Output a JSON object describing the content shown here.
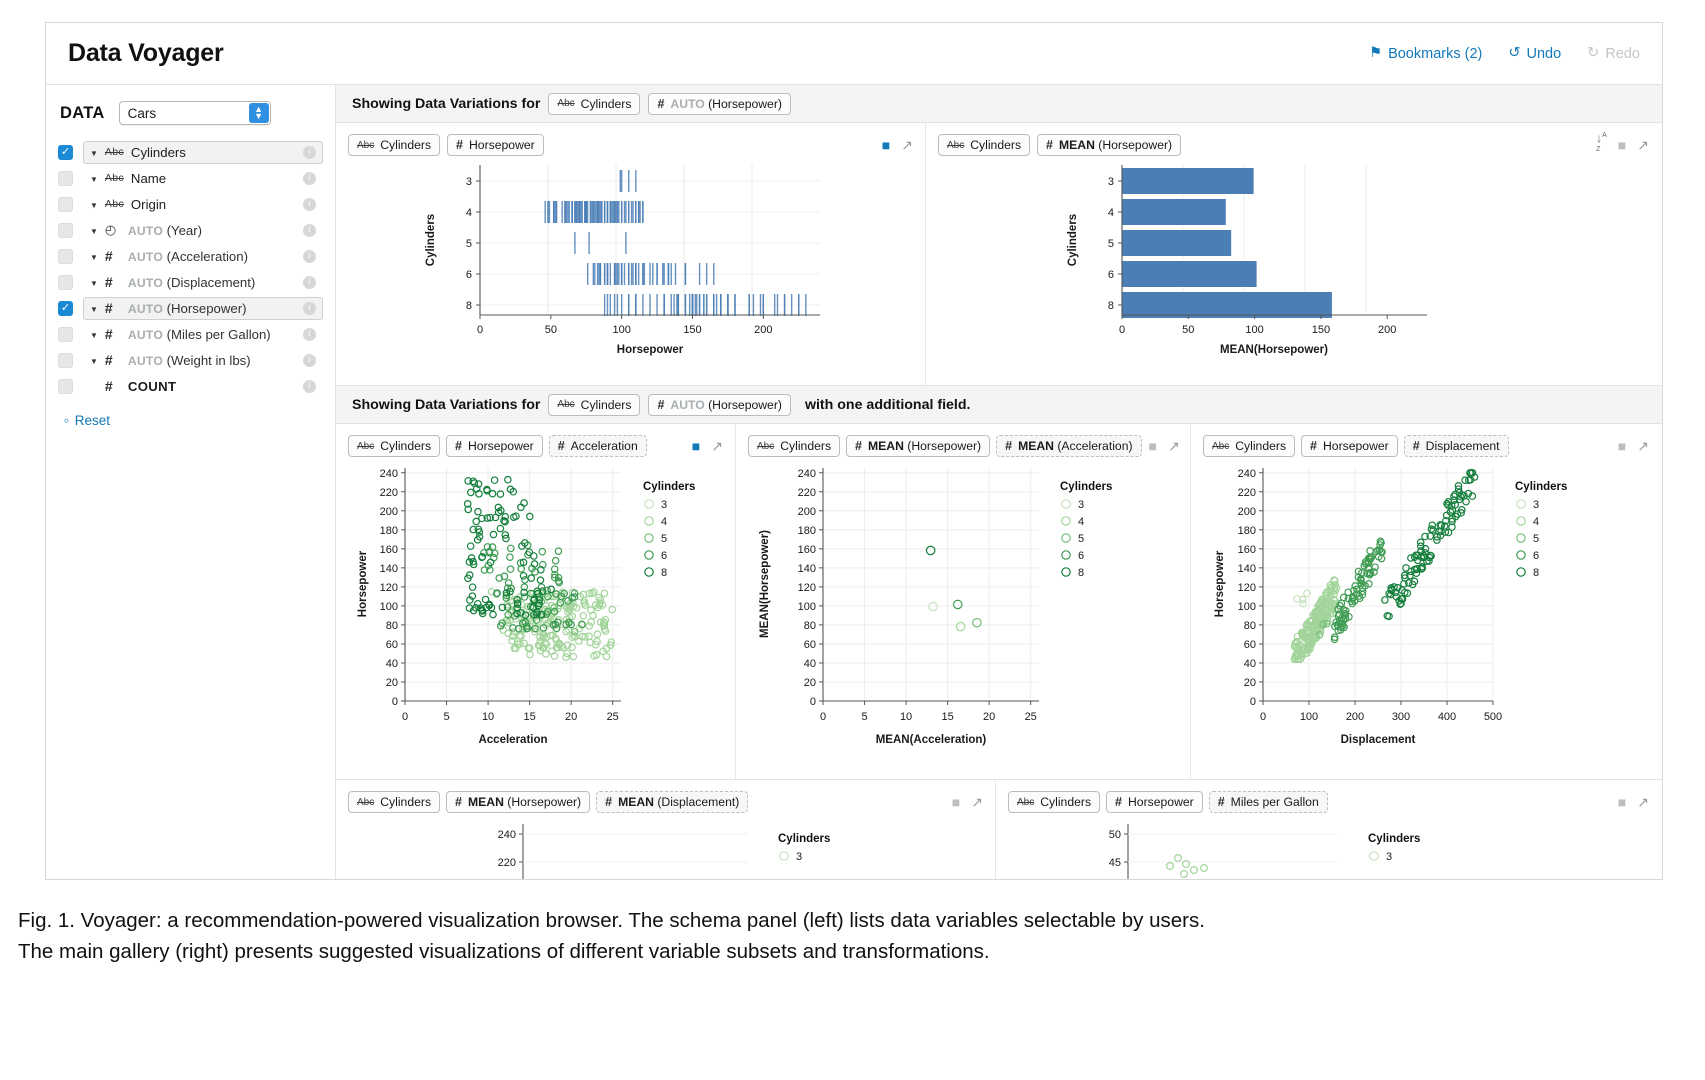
{
  "app": {
    "title": "Data Voyager",
    "toolbar": [
      {
        "name": "bookmarks",
        "label": "Bookmarks (2)",
        "icon": "bookmark-icon",
        "glyph": "⚑",
        "disabled": false
      },
      {
        "name": "undo",
        "label": "Undo",
        "icon": "undo-icon",
        "glyph": "↺",
        "disabled": false
      },
      {
        "name": "redo",
        "label": "Redo",
        "icon": "redo-icon",
        "glyph": "↻",
        "disabled": true
      }
    ]
  },
  "sidebar": {
    "heading": "DATA",
    "dataset": {
      "value": "Cars",
      "options": [
        "Cars"
      ]
    },
    "reset_label": "Reset",
    "reset_icon": "eraser-icon",
    "fields": [
      {
        "label": "Cylinders",
        "type": "abc",
        "type_glyph": "Abc",
        "checked": true,
        "selected": true,
        "auto": false,
        "caret": true,
        "bold": false
      },
      {
        "label": "Name",
        "type": "abc",
        "type_glyph": "Abc",
        "checked": false,
        "selected": false,
        "auto": false,
        "caret": true,
        "bold": false
      },
      {
        "label": "Origin",
        "type": "abc",
        "type_glyph": "Abc",
        "checked": false,
        "selected": false,
        "auto": false,
        "caret": true,
        "bold": false
      },
      {
        "label": "(Year)",
        "type": "clock",
        "type_glyph": "◴",
        "checked": false,
        "selected": false,
        "auto": true,
        "caret": true,
        "bold": false
      },
      {
        "label": "(Acceleration)",
        "type": "hash",
        "type_glyph": "#",
        "checked": false,
        "selected": false,
        "auto": true,
        "caret": true,
        "bold": false
      },
      {
        "label": "(Displacement)",
        "type": "hash",
        "type_glyph": "#",
        "checked": false,
        "selected": false,
        "auto": true,
        "caret": true,
        "bold": false
      },
      {
        "label": "(Horsepower)",
        "type": "hash",
        "type_glyph": "#",
        "checked": true,
        "selected": true,
        "auto": true,
        "caret": true,
        "bold": false
      },
      {
        "label": "(Miles per Gallon)",
        "type": "hash",
        "type_glyph": "#",
        "checked": false,
        "selected": false,
        "auto": true,
        "caret": true,
        "bold": false
      },
      {
        "label": "(Weight in lbs)",
        "type": "hash",
        "type_glyph": "#",
        "checked": false,
        "selected": false,
        "auto": true,
        "caret": true,
        "bold": false
      },
      {
        "label": "COUNT",
        "type": "hash",
        "type_glyph": "#",
        "checked": false,
        "selected": false,
        "auto": false,
        "caret": false,
        "bold": true
      }
    ],
    "auto_text": "AUTO",
    "info_glyph": "i"
  },
  "gallery": {
    "section1": {
      "prefix": "Showing Data Variations for",
      "suffix": "",
      "pills": [
        {
          "type": "abc",
          "glyph": "Abc",
          "label": "Cylinders",
          "auto": false,
          "dashed": false
        },
        {
          "type": "hash",
          "glyph": "#",
          "label": "(Horsepower)",
          "auto": true,
          "dashed": false
        }
      ]
    },
    "section2": {
      "prefix": "Showing Data Variations for",
      "suffix": "with one additional field.",
      "pills": [
        {
          "type": "abc",
          "glyph": "Abc",
          "label": "Cylinders",
          "auto": false,
          "dashed": false
        },
        {
          "type": "hash",
          "glyph": "#",
          "label": "(Horsepower)",
          "auto": true,
          "dashed": false
        }
      ]
    },
    "cards": [
      {
        "id": "c1",
        "pills": [
          {
            "type": "abc",
            "glyph": "Abc",
            "label": "Cylinders",
            "dashed": false
          },
          {
            "type": "hash",
            "glyph": "#",
            "label": "Horsepower",
            "dashed": false
          }
        ],
        "bookmarked": true,
        "sortable": false
      },
      {
        "id": "c2",
        "pills": [
          {
            "type": "abc",
            "glyph": "Abc",
            "label": "Cylinders",
            "dashed": false
          },
          {
            "type": "hash",
            "glyph": "#",
            "label": "MEAN (Horsepower)",
            "bold_prefix": "MEAN",
            "dashed": false
          }
        ],
        "bookmarked": false,
        "sortable": true
      },
      {
        "id": "c3",
        "pills": [
          {
            "type": "abc",
            "glyph": "Abc",
            "label": "Cylinders",
            "dashed": false
          },
          {
            "type": "hash",
            "glyph": "#",
            "label": "Horsepower",
            "dashed": false
          },
          {
            "type": "hash",
            "glyph": "#",
            "label": "Acceleration",
            "dashed": true
          }
        ],
        "bookmarked": true,
        "sortable": false
      },
      {
        "id": "c4",
        "pills": [
          {
            "type": "abc",
            "glyph": "Abc",
            "label": "Cylinders",
            "dashed": false
          },
          {
            "type": "hash",
            "glyph": "#",
            "label": "MEAN (Horsepower)",
            "dashed": false
          },
          {
            "type": "hash",
            "glyph": "#",
            "label": "MEAN (Acceleration)",
            "dashed": true
          }
        ],
        "bookmarked": false,
        "sortable": false
      },
      {
        "id": "c5",
        "pills": [
          {
            "type": "abc",
            "glyph": "Abc",
            "label": "Cylinders",
            "dashed": false
          },
          {
            "type": "hash",
            "glyph": "#",
            "label": "Horsepower",
            "dashed": false
          },
          {
            "type": "hash",
            "glyph": "#",
            "label": "Displacement",
            "dashed": true
          }
        ],
        "bookmarked": false,
        "sortable": false
      },
      {
        "id": "c6",
        "pills": [
          {
            "type": "abc",
            "glyph": "Abc",
            "label": "Cylinders",
            "dashed": false
          },
          {
            "type": "hash",
            "glyph": "#",
            "label": "MEAN (Horsepower)",
            "dashed": false
          },
          {
            "type": "hash",
            "glyph": "#",
            "label": "MEAN (Displacement)",
            "dashed": true
          }
        ],
        "bookmarked": false,
        "sortable": false
      },
      {
        "id": "c7",
        "pills": [
          {
            "type": "abc",
            "glyph": "Abc",
            "label": "Cylinders",
            "dashed": false
          },
          {
            "type": "hash",
            "glyph": "#",
            "label": "Horsepower",
            "dashed": false
          },
          {
            "type": "hash",
            "glyph": "#",
            "label": "Miles per Gallon",
            "dashed": true
          }
        ],
        "bookmarked": false,
        "sortable": false
      }
    ]
  },
  "colors": {
    "accent": "#1279b8",
    "checkbox": "#1b8ad6",
    "bar_blue": "#4a7eb5",
    "tick_blue": "#4a7eb5",
    "green_scale": [
      "#c7e3bf",
      "#a3d49b",
      "#74bf77",
      "#3f9c53",
      "#157f3c"
    ]
  },
  "chart_data": [
    {
      "id": "c1",
      "type": "scatter",
      "render": "strip",
      "title": "",
      "xlabel": "Horsepower",
      "ylabel": "Cylinders",
      "xlim": [
        0,
        240
      ],
      "xticks": [
        0,
        50,
        100,
        150,
        200
      ],
      "ycategories": [
        "3",
        "4",
        "5",
        "6",
        "8"
      ],
      "grid": true,
      "color": "#4a7eb5",
      "series": [
        {
          "name": "3",
          "values": [
            99,
            100,
            105,
            110
          ]
        },
        {
          "name": "4",
          "values": [
            46,
            48,
            48,
            49,
            52,
            52,
            53,
            54,
            54,
            58,
            60,
            60,
            60,
            61,
            62,
            63,
            65,
            65,
            65,
            67,
            67,
            68,
            68,
            69,
            70,
            70,
            70,
            71,
            72,
            72,
            74,
            74,
            75,
            75,
            75,
            76,
            78,
            78,
            79,
            80,
            80,
            81,
            82,
            83,
            83,
            84,
            84,
            85,
            86,
            86,
            88,
            88,
            88,
            90,
            90,
            90,
            92,
            92,
            93,
            94,
            95,
            95,
            95,
            96,
            97,
            97,
            98,
            100,
            100,
            102,
            103,
            105,
            105,
            107,
            108,
            110,
            110,
            112,
            112,
            113,
            115,
            115
          ]
        },
        {
          "name": "5",
          "values": [
            67,
            77,
            103
          ]
        },
        {
          "name": "6",
          "values": [
            76,
            80,
            81,
            83,
            84,
            85,
            85,
            88,
            88,
            90,
            90,
            90,
            92,
            95,
            95,
            96,
            97,
            98,
            100,
            100,
            100,
            100,
            102,
            105,
            105,
            105,
            107,
            108,
            110,
            110,
            110,
            110,
            112,
            115,
            115,
            116,
            120,
            122,
            125,
            125,
            129,
            130,
            133,
            133,
            133,
            135,
            138,
            145,
            145,
            155,
            160,
            165
          ]
        },
        {
          "name": "8",
          "values": [
            88,
            90,
            92,
            95,
            97,
            100,
            105,
            105,
            110,
            110,
            110,
            115,
            120,
            125,
            130,
            130,
            130,
            135,
            137,
            139,
            140,
            140,
            140,
            145,
            145,
            148,
            150,
            150,
            150,
            150,
            150,
            152,
            153,
            155,
            155,
            158,
            158,
            160,
            160,
            165,
            165,
            165,
            167,
            170,
            170,
            170,
            175,
            175,
            175,
            180,
            180,
            190,
            190,
            193,
            198,
            200,
            200,
            208,
            210,
            215,
            215,
            220,
            225,
            225,
            230
          ]
        }
      ]
    },
    {
      "id": "c2",
      "type": "bar",
      "orientation": "horizontal",
      "xlabel": "MEAN(Horsepower)",
      "ylabel": "Cylinders",
      "categories": [
        "3",
        "4",
        "5",
        "6",
        "8"
      ],
      "values": [
        99.25,
        78.28,
        82.33,
        101.51,
        158.3
      ],
      "xlim": [
        0,
        230
      ],
      "xticks": [
        0,
        50,
        100,
        150,
        200
      ],
      "grid": true,
      "color": "#4a7eb5"
    },
    {
      "id": "c3",
      "type": "scatter",
      "xlabel": "Acceleration",
      "ylabel": "Horsepower",
      "xlim": [
        0,
        26
      ],
      "ylim": [
        0,
        245
      ],
      "xticks": [
        0,
        5,
        10,
        15,
        20,
        25
      ],
      "yticks": [
        0,
        20,
        40,
        60,
        80,
        100,
        120,
        140,
        160,
        180,
        200,
        220,
        240
      ],
      "legend": {
        "title": "Cylinders",
        "position": "right",
        "entries": [
          "3",
          "4",
          "5",
          "6",
          "8"
        ]
      },
      "grid": true
    },
    {
      "id": "c4",
      "type": "scatter",
      "xlabel": "MEAN(Acceleration)",
      "ylabel": "MEAN(Horsepower)",
      "xlim": [
        0,
        26
      ],
      "ylim": [
        0,
        245
      ],
      "xticks": [
        0,
        5,
        10,
        15,
        20,
        25
      ],
      "yticks": [
        0,
        20,
        40,
        60,
        80,
        100,
        120,
        140,
        160,
        180,
        200,
        220,
        240
      ],
      "legend": {
        "title": "Cylinders",
        "position": "right",
        "entries": [
          "3",
          "4",
          "5",
          "6",
          "8"
        ]
      },
      "grid": true,
      "points": [
        {
          "cyl": "3",
          "x": 13.25,
          "y": 99.25
        },
        {
          "cyl": "4",
          "x": 16.57,
          "y": 78.28
        },
        {
          "cyl": "5",
          "x": 18.53,
          "y": 82.33
        },
        {
          "cyl": "6",
          "x": 16.22,
          "y": 101.51
        },
        {
          "cyl": "8",
          "x": 12.96,
          "y": 158.3
        }
      ]
    },
    {
      "id": "c5",
      "type": "scatter",
      "xlabel": "Displacement",
      "ylabel": "Horsepower",
      "xlim": [
        0,
        500
      ],
      "ylim": [
        0,
        245
      ],
      "xticks": [
        0,
        100,
        200,
        300,
        400,
        500
      ],
      "yticks": [
        0,
        20,
        40,
        60,
        80,
        100,
        120,
        140,
        160,
        180,
        200,
        220,
        240
      ],
      "legend": {
        "title": "Cylinders",
        "position": "right",
        "entries": [
          "3",
          "4",
          "5",
          "6",
          "8"
        ]
      },
      "grid": true
    },
    {
      "id": "c6",
      "type": "scatter",
      "xlabel": "",
      "ylabel": "",
      "yticks": [
        240,
        220
      ],
      "legend": {
        "title": "Cylinders",
        "position": "right",
        "entries": [
          "3"
        ]
      },
      "grid": true,
      "clipped": true
    },
    {
      "id": "c7",
      "type": "scatter",
      "xlabel": "",
      "ylabel": "",
      "yticks": [
        50,
        45
      ],
      "legend": {
        "title": "Cylinders",
        "position": "right",
        "entries": [
          "3"
        ]
      },
      "grid": true,
      "clipped": true
    }
  ],
  "caption": {
    "line1": "Fig. 1.   Voyager: a recommendation-powered visualization browser. The schema panel (left) lists data variables selectable by users.",
    "line2": "The main gallery (right) presents suggested visualizations of different variable subsets and transformations."
  }
}
